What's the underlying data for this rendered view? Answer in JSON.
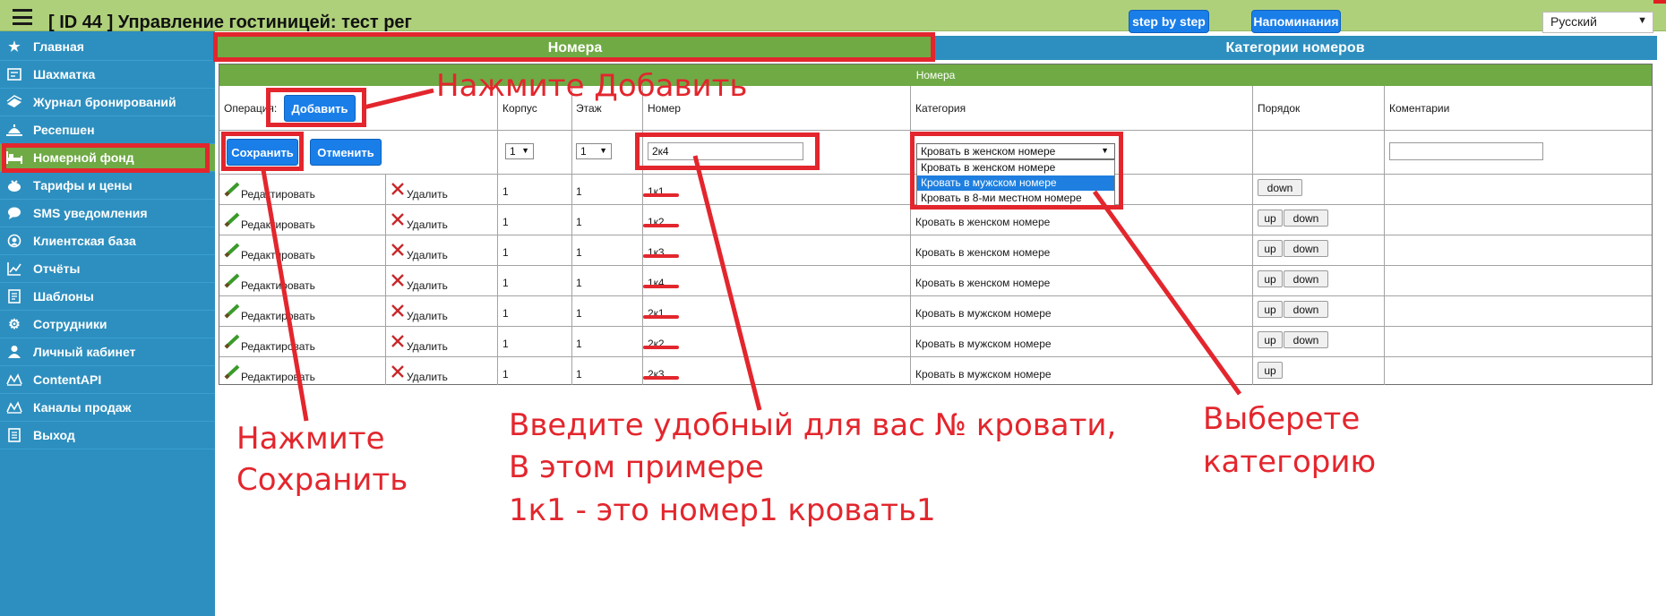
{
  "header": {
    "title": "[ ID 44 ] Управление гостиницей: тест рег",
    "step_by_step_label": "step by step",
    "reminders_label": "Напоминания",
    "language": "Русский"
  },
  "sidebar": {
    "items": [
      {
        "label": "Главная",
        "icon": "star-icon"
      },
      {
        "label": "Шахматка",
        "icon": "grid-icon"
      },
      {
        "label": "Журнал бронирований",
        "icon": "book-icon"
      },
      {
        "label": "Ресепшен",
        "icon": "reception-icon"
      },
      {
        "label": "Номерной фонд",
        "icon": "bed-icon",
        "active": true
      },
      {
        "label": "Тарифы и цены",
        "icon": "money-icon"
      },
      {
        "label": "SMS уведомления",
        "icon": "sms-icon"
      },
      {
        "label": "Клиентская база",
        "icon": "user-database-icon"
      },
      {
        "label": "Отчёты",
        "icon": "chart-icon"
      },
      {
        "label": "Шаблоны",
        "icon": "template-icon"
      },
      {
        "label": "Сотрудники",
        "icon": "gear-icon"
      },
      {
        "label": "Личный кабинет",
        "icon": "person-icon"
      },
      {
        "label": "ContentAPI",
        "icon": "api-icon"
      },
      {
        "label": "Каналы продаж",
        "icon": "channel-icon"
      },
      {
        "label": "Выход",
        "icon": "exit-icon"
      }
    ]
  },
  "tabs": [
    {
      "label": "Номера",
      "active": true
    },
    {
      "label": "Категории номеров",
      "active": false
    }
  ],
  "table": {
    "title": "Номера",
    "operation_label": "Операция:",
    "add_label": "Добавить",
    "columns": {
      "building": "Корпус",
      "floor": "Этаж",
      "room": "Номер",
      "category": "Категория",
      "order": "Порядок",
      "comments": "Коментарии"
    },
    "form": {
      "save_label": "Сохранить",
      "cancel_label": "Отменить",
      "building_value": "1",
      "floor_value": "1",
      "room_value": "2к4",
      "category_value": "Кровать в женском номере",
      "category_options": [
        "Кровать в женском номере",
        "Кровать в мужском номере",
        "Кровать в 8-ми местном номере"
      ],
      "comments_value": ""
    },
    "edit_label": "Редактировать",
    "delete_label": "Удалить",
    "up_label": "up",
    "down_label": "down",
    "rows": [
      {
        "building": "1",
        "floor": "1",
        "room": "1к1",
        "category": ""
      },
      {
        "building": "1",
        "floor": "1",
        "room": "1к2",
        "category": "Кровать в женском номере"
      },
      {
        "building": "1",
        "floor": "1",
        "room": "1к3",
        "category": "Кровать в женском номере"
      },
      {
        "building": "1",
        "floor": "1",
        "room": "1к4",
        "category": "Кровать в женском номере"
      },
      {
        "building": "1",
        "floor": "1",
        "room": "2к1",
        "category": "Кровать в мужском номере"
      },
      {
        "building": "1",
        "floor": "1",
        "room": "2к2",
        "category": "Кровать в мужском номере"
      },
      {
        "building": "1",
        "floor": "1",
        "room": "2к3",
        "category": "Кровать в мужском номере"
      }
    ]
  },
  "annotations": {
    "click_add": "Нажмите Добавить",
    "click_save_1": "Нажмите",
    "click_save_2": "Сохранить",
    "enter_number_1": "Введите удобный для вас № кровати,",
    "enter_number_2": "В этом примере",
    "enter_number_3": "1к1 - это номер1 кровать1",
    "choose_category_1": "Выберете",
    "choose_category_2": "категорию",
    "color": "#e3262d"
  }
}
